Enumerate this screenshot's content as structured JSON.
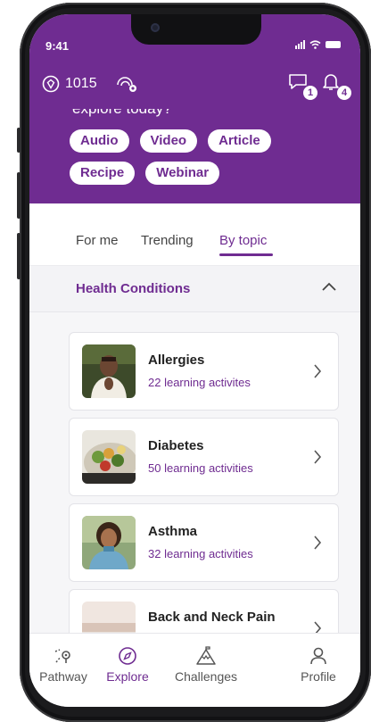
{
  "status": {
    "time": "9:41"
  },
  "header": {
    "points": "1015",
    "partial_text": "explore today?",
    "messages_count": "1",
    "notifications_count": "4",
    "chips": [
      "Audio",
      "Video",
      "Article",
      "Recipe",
      "Webinar"
    ]
  },
  "tabs": [
    {
      "label": "For me"
    },
    {
      "label": "Trending"
    },
    {
      "label": "By topic"
    }
  ],
  "section": {
    "title": "Health Conditions"
  },
  "topics": [
    {
      "title": "Allergies",
      "subtitle": "22 learning activites",
      "thumb": "person-meditating"
    },
    {
      "title": "Diabetes",
      "subtitle": "50 learning activities",
      "thumb": "salad-bowl"
    },
    {
      "title": "Asthma",
      "subtitle": "32 learning activities",
      "thumb": "smiling-woman"
    },
    {
      "title": "Back and Neck Pain",
      "subtitle": "",
      "thumb": "landscape"
    }
  ],
  "bottom_nav": [
    {
      "label": "Pathway",
      "icon": "pathway-icon"
    },
    {
      "label": "Explore",
      "icon": "compass-icon"
    },
    {
      "label": "Challenges",
      "icon": "mountain-icon"
    },
    {
      "label": "Profile",
      "icon": "person-icon"
    }
  ],
  "colors": {
    "brand": "#6f2c91",
    "background": "#f6f6f8",
    "text": "#222222"
  }
}
